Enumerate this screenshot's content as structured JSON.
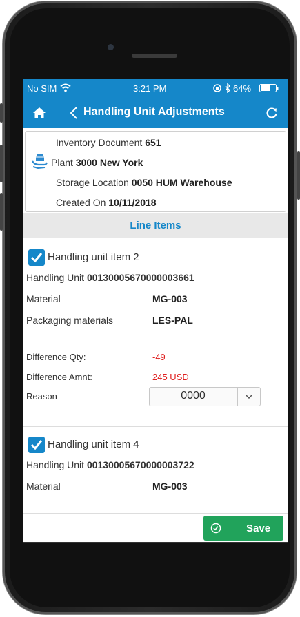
{
  "status": {
    "carrier": "No SIM",
    "time": "3:21 PM",
    "battery": "64%"
  },
  "nav": {
    "title": "Handling Unit Adjustments"
  },
  "header": {
    "doc_label": "Inventory Document",
    "doc_value": "651",
    "plant_label": "Plant",
    "plant_value": "3000 New York",
    "sloc_label": "Storage Location",
    "sloc_value": "0050 HUM Warehouse",
    "created_label": "Created On",
    "created_value": "10/11/2018"
  },
  "section": {
    "title": "Line Items"
  },
  "items": [
    {
      "title_label": "Handling unit item",
      "title_num": "2",
      "hu_label": "Handling Unit",
      "hu_value": "00130005670000003661",
      "material_label": "Material",
      "material_value": "MG-003",
      "pack_label": "Packaging materials",
      "pack_value": "LES-PAL",
      "diffqty_label": "Difference Qty:",
      "diffqty_value": "-49",
      "diffamt_label": "Difference Amnt:",
      "diffamt_value": "245 USD",
      "reason_label": "Reason",
      "reason_value": "0000"
    },
    {
      "title_label": "Handling unit item",
      "title_num": "4",
      "hu_label": "Handling Unit",
      "hu_value": "00130005670000003722",
      "material_label": "Material",
      "material_value": "MG-003"
    }
  ],
  "footer": {
    "save_label": "Save"
  },
  "colors": {
    "accent": "#1587c9",
    "save": "#21a35b",
    "negative": "#e02020"
  }
}
